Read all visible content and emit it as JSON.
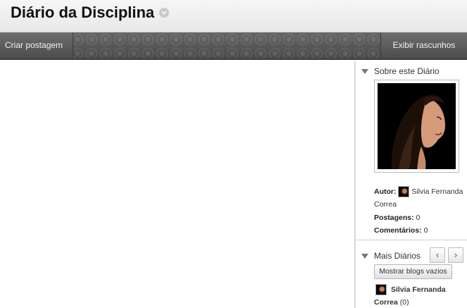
{
  "header": {
    "title": "Diário da Disciplina",
    "chevron_icon": "chevron-down-circle-icon"
  },
  "action_bar": {
    "create_post": "Criar postagem",
    "view_drafts": "Exibir rascunhos"
  },
  "sidebar": {
    "about": {
      "title": "Sobre este Diário",
      "author_label": "Autor:",
      "author_first": "Silvia Fernanda",
      "author_last": "Correa",
      "posts_label": "Postagens:",
      "posts_count": "0",
      "comments_label": "Comentários:",
      "comments_count": "0"
    },
    "more": {
      "title": "Mais Diários",
      "prev_label": "‹",
      "next_label": "›",
      "show_empty": "Mostrar blogs vazios",
      "blog_first": "Silvia Fernanda",
      "blog_last": "Correa",
      "blog_count": "(0)"
    }
  }
}
